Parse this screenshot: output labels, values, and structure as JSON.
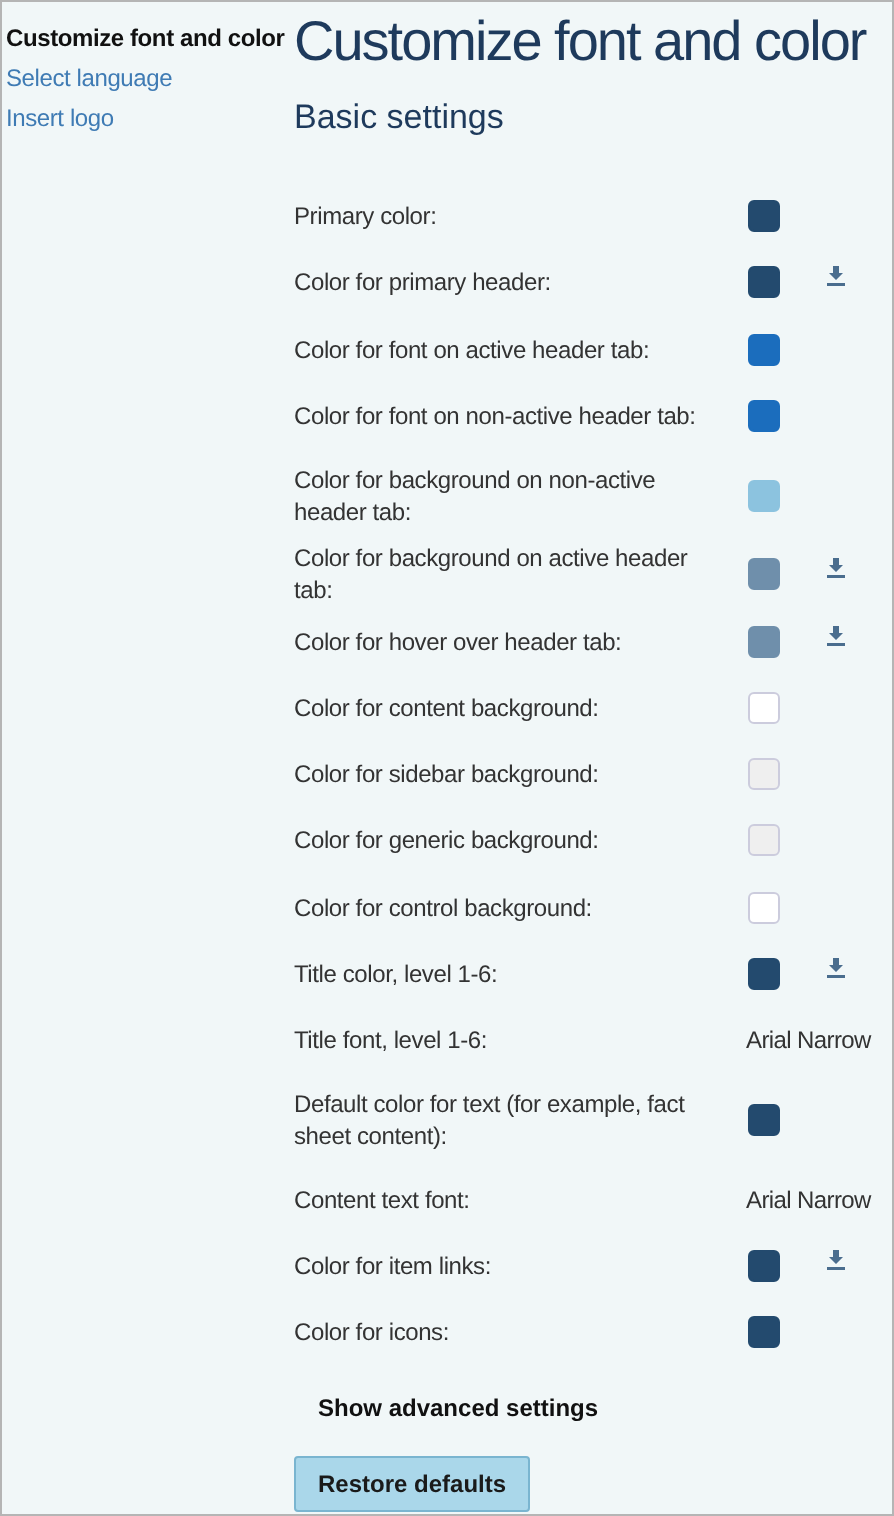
{
  "sidebar": {
    "items": [
      {
        "label": "Customize font and color",
        "selected": true
      },
      {
        "label": "Select language",
        "selected": false
      },
      {
        "label": "Insert logo",
        "selected": false
      }
    ]
  },
  "title": "Customize font and color",
  "section_title": "Basic settings",
  "settings": [
    {
      "kind": "color",
      "label": "Primary color:",
      "color": "#234a6e",
      "download": false
    },
    {
      "kind": "color",
      "label": "Color for primary header:",
      "color": "#234a6e",
      "download": true
    },
    {
      "kind": "color",
      "label": "Color for font on active header tab:",
      "color": "#1b6dbd",
      "download": false
    },
    {
      "kind": "color",
      "label": "Color for font on non-active header tab:",
      "color": "#1b6dbd",
      "download": false
    },
    {
      "kind": "color",
      "label": "Color for background on non-active header tab:",
      "color": "#8cc3df",
      "download": false
    },
    {
      "kind": "color",
      "label": "Color for background on active header tab:",
      "color": "#6f8fab",
      "download": true
    },
    {
      "kind": "color",
      "label": "Color for hover over header tab:",
      "color": "#6f8fab",
      "download": true
    },
    {
      "kind": "color",
      "label": "Color for content background:",
      "color": "#ffffff",
      "download": false
    },
    {
      "kind": "color",
      "label": "Color for sidebar background:",
      "color": "#efefef",
      "download": false
    },
    {
      "kind": "color",
      "label": "Color for generic background:",
      "color": "#efefef",
      "download": false
    },
    {
      "kind": "color",
      "label": "Color for control background:",
      "color": "#ffffff",
      "download": false
    },
    {
      "kind": "color",
      "label": "Title color, level 1-6:",
      "color": "#234a6e",
      "download": true
    },
    {
      "kind": "font",
      "label": "Title font, level 1-6:",
      "value": "Arial Narrow"
    },
    {
      "kind": "color",
      "label": "Default color for text (for example, fact sheet content):",
      "color": "#234a6e",
      "download": false
    },
    {
      "kind": "font",
      "label": "Content text font:",
      "value": "Arial Narrow"
    },
    {
      "kind": "color",
      "label": "Color for item links:",
      "color": "#234a6e",
      "download": true
    },
    {
      "kind": "color",
      "label": "Color for icons:",
      "color": "#234a6e",
      "download": false
    }
  ],
  "advanced_link": "Show advanced settings",
  "restore_button": "Restore defaults"
}
